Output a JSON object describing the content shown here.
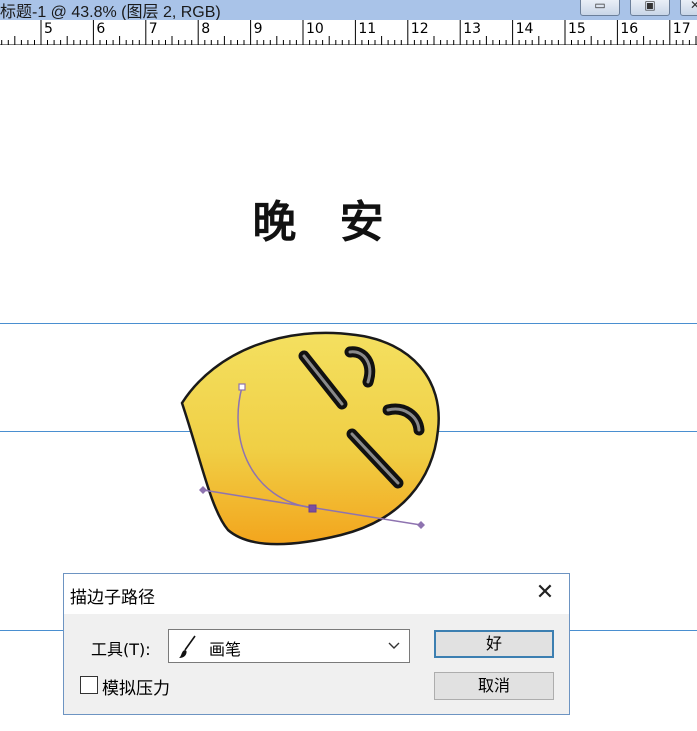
{
  "window": {
    "title": "标题-1 @ 43.8% (图层 2, RGB)",
    "minimize_glyph": "▭",
    "restore_glyph": "▣",
    "close_glyph": "✕"
  },
  "ruler": {
    "labels": [
      "5",
      "6",
      "7",
      "8",
      "9",
      "10",
      "11",
      "12",
      "13",
      "14",
      "15",
      "16",
      "17"
    ]
  },
  "canvas": {
    "greeting": "晚 安"
  },
  "dialog": {
    "title": "描边子路径",
    "close_glyph": "✕",
    "tool_label": "工具(T):",
    "tool_value": "画笔",
    "simulate_pressure_label": "模拟压力",
    "simulate_pressure_checked": false,
    "ok_label": "好",
    "cancel_label": "取消"
  },
  "colors": {
    "guide": "#4a8fd0",
    "face_top": "#f2dc5c",
    "face_bottom": "#f3a51d",
    "path": "#8e73b0",
    "dialog_border": "#6d94c2",
    "ok_border": "#3c7fb1"
  }
}
